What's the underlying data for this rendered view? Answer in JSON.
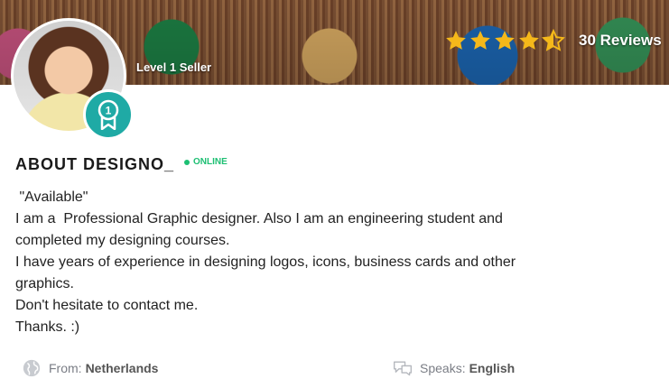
{
  "header": {
    "level_label": "Level 1 Seller",
    "rating": {
      "stars": 4.5,
      "max": 5,
      "reviews_label": "30 Reviews",
      "star_color": "#f5b81a"
    },
    "badge_color": "#1faaa5"
  },
  "about": {
    "title": "ABOUT DESIGNO_",
    "status": "ONLINE",
    "status_color": "#1dbf73",
    "lines": [
      " \"Available\"",
      "I am a  Professional Graphic designer. Also I am an engineering student and completed my designing courses.",
      "I have years of experience in designing logos, icons, business cards and other graphics.",
      "Don't hesitate to contact me.",
      "Thanks. :)"
    ]
  },
  "info": {
    "from_label": "From:",
    "from_value": "Netherlands",
    "speaks_label": "Speaks:",
    "speaks_value": "English"
  }
}
